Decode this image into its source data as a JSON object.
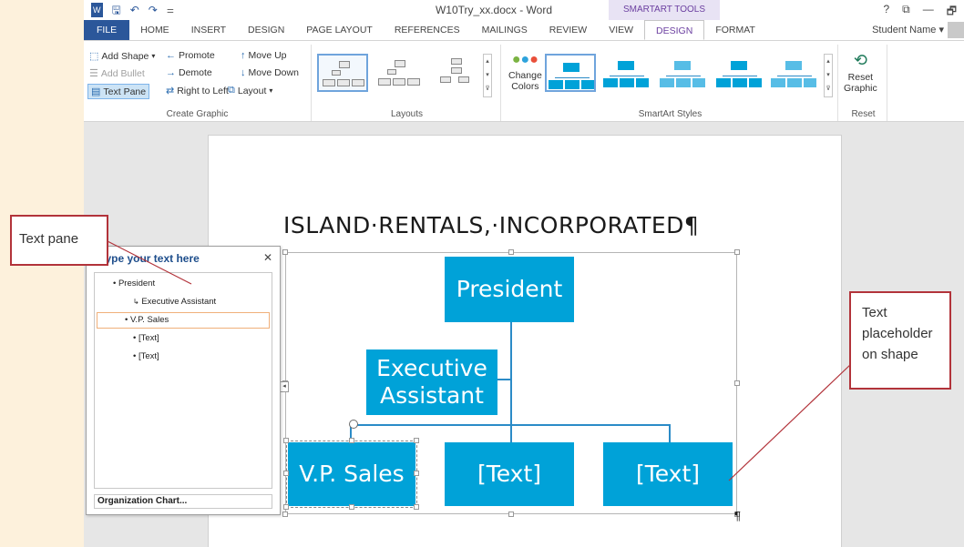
{
  "window": {
    "title": "W10Try_xx.docx - Word",
    "context_tools_label": "SMARTART TOOLS",
    "controls": [
      "?",
      "⧉",
      "—",
      "🗗"
    ]
  },
  "quick_access": {
    "icons": [
      "word-app-icon",
      "save-icon",
      "undo-icon",
      "redo-icon",
      "customize-qat-icon"
    ]
  },
  "tabs": [
    {
      "label": "FILE"
    },
    {
      "label": "HOME"
    },
    {
      "label": "INSERT"
    },
    {
      "label": "DESIGN"
    },
    {
      "label": "PAGE LAYOUT"
    },
    {
      "label": "REFERENCES"
    },
    {
      "label": "MAILINGS"
    },
    {
      "label": "REVIEW"
    },
    {
      "label": "VIEW"
    },
    {
      "label": "DESIGN"
    },
    {
      "label": "FORMAT"
    }
  ],
  "user": {
    "name": "Student Name ▾"
  },
  "ribbon": {
    "create_graphic": {
      "label": "Create Graphic",
      "add_shape": "Add Shape",
      "add_bullet": "Add Bullet",
      "text_pane": "Text Pane",
      "promote": "Promote",
      "demote": "Demote",
      "right_to_left": "Right to Left",
      "move_up": "Move Up",
      "move_down": "Move Down",
      "layout": "Layout"
    },
    "layouts": {
      "label": "Layouts"
    },
    "smartart_styles": {
      "label": "SmartArt Styles",
      "change_colors_line1": "Change",
      "change_colors_line2": "Colors"
    },
    "reset": {
      "label": "Reset",
      "reset_graphic_line1": "Reset",
      "reset_graphic_line2": "Graphic"
    }
  },
  "document": {
    "heading": "ISLAND·RENTALS,·INCORPORATED¶",
    "paragraph_mark": "¶"
  },
  "smartart": {
    "president": "President",
    "assistant_line1": "Executive",
    "assistant_line2": "Assistant",
    "vp_sales": "V.P. Sales",
    "text_2": "[Text]",
    "text_3": "[Text]",
    "fill_color": "#00a2d8"
  },
  "text_pane": {
    "title": "Type your text here",
    "items": [
      {
        "label": "President"
      },
      {
        "label": "Executive Assistant"
      },
      {
        "label": "V.P. Sales"
      },
      {
        "label": "[Text]"
      },
      {
        "label": "[Text]"
      }
    ],
    "footer": "Organization Chart..."
  },
  "callouts": {
    "text_pane": "Text pane",
    "placeholder_line1": "Text",
    "placeholder_line2": "placeholder",
    "placeholder_line3": "on shape",
    "border_color": "#b2333a"
  }
}
